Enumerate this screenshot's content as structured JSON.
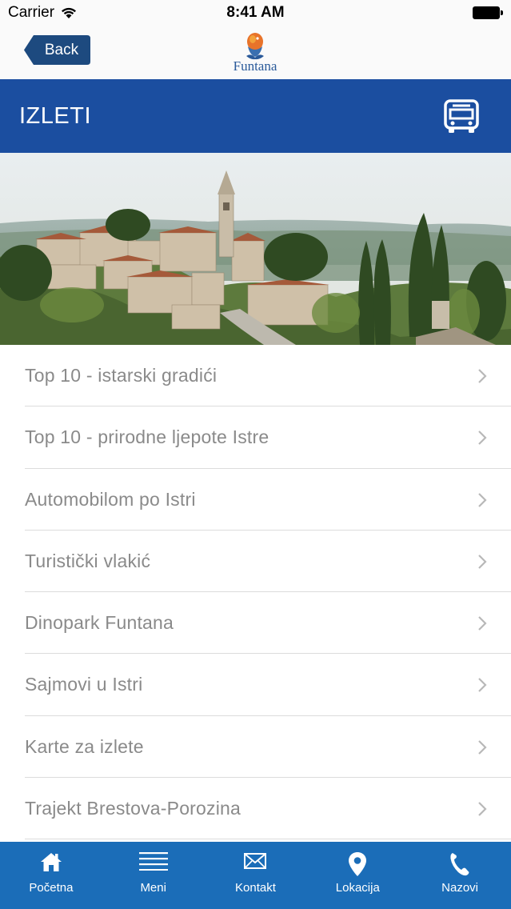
{
  "status_bar": {
    "carrier": "Carrier",
    "time": "8:41 AM"
  },
  "nav": {
    "back_label": "Back",
    "logo_text": "Funtana"
  },
  "header": {
    "title": "IZLETI",
    "icon": "bus-icon"
  },
  "hero": {
    "icon": "istrian-hill-town-photo"
  },
  "list": {
    "items": [
      {
        "label": "Top 10 - istarski gradići"
      },
      {
        "label": "Top 10 - prirodne ljepote Istre"
      },
      {
        "label": "Automobilom po Istri"
      },
      {
        "label": "Turistički vlakić"
      },
      {
        "label": "Dinopark Funtana"
      },
      {
        "label": "Sajmovi u Istri"
      },
      {
        "label": "Karte za izlete"
      },
      {
        "label": "Trajekt Brestova-Porozina"
      }
    ]
  },
  "tabs": [
    {
      "label": "Početna",
      "icon": "home-icon"
    },
    {
      "label": "Meni",
      "icon": "menu-icon"
    },
    {
      "label": "Kontakt",
      "icon": "mail-icon"
    },
    {
      "label": "Lokacija",
      "icon": "location-pin-icon"
    },
    {
      "label": "Nazovi",
      "icon": "phone-icon"
    }
  ],
  "colors": {
    "header_blue": "#1b4ea0",
    "tab_bar_blue": "#1b6db8",
    "back_button": "#1d4a7f",
    "list_text": "#8a8a8a"
  }
}
